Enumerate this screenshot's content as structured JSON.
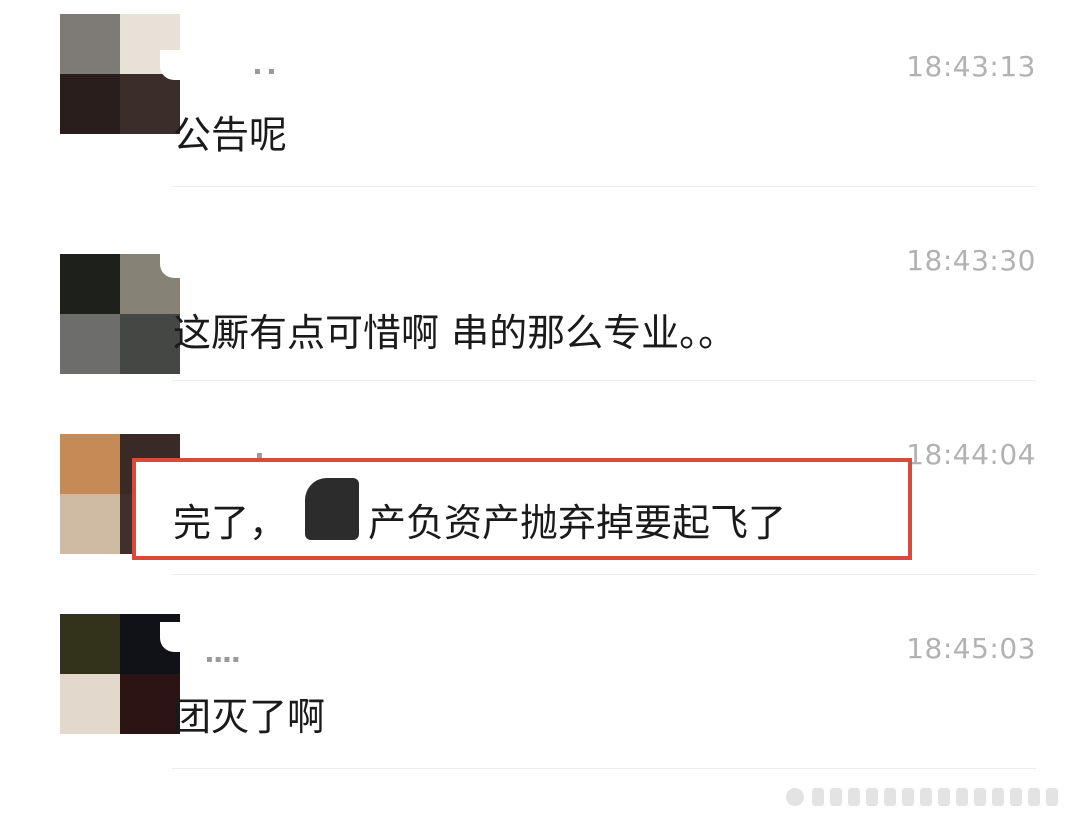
{
  "messages": [
    {
      "time": "18:43:13",
      "text": "公告呢",
      "nickname_residue": "▪ ▪"
    },
    {
      "time": "18:43:30",
      "text": "这厮有点可惜啊 串的那么专业。。",
      "nickname_residue": ""
    },
    {
      "time": "18:44:04",
      "text": "完了，",
      "text_after": "产负资产抛弃掉要起飞了",
      "nickname_residue": "▪"
    },
    {
      "time": "18:45:03",
      "text": "团灭了啊",
      "nickname_residue": "▪▪▪▪"
    }
  ],
  "colors": {
    "highlight_border": "#d94a3a",
    "timestamp": "#b2b2b2",
    "message_text": "#1a1a1a",
    "divider": "#ececec"
  },
  "avatars": [
    [
      "#7e7b76",
      "#e7e1d8",
      "#2a1e1c",
      "#3b2e2a"
    ],
    [
      "#1d201b",
      "#878276",
      "#6d6e6c",
      "#454744"
    ],
    [
      "#c68a57",
      "#3a2a26",
      "#cfbba4",
      "#3f302a"
    ],
    [
      "#33331c",
      "#111217",
      "#e2d9cc",
      "#2b1413"
    ]
  ]
}
